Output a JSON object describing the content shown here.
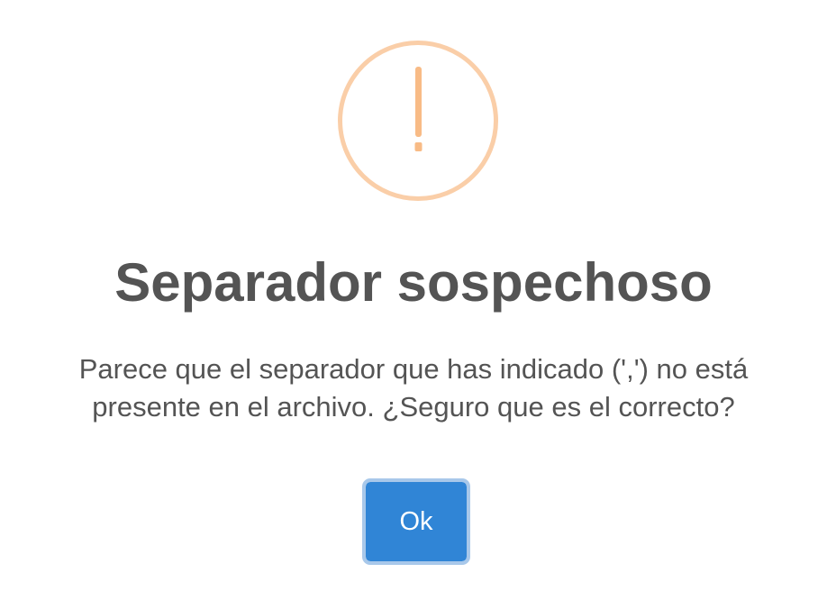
{
  "dialog": {
    "icon": "warning-icon",
    "title": "Separador sospechoso",
    "message_line1": "Parece que el separador que has indicado (',') no está",
    "message_line2": "presente en el archivo. ¿Seguro que es el correcto?",
    "confirm_label": "Ok"
  },
  "colors": {
    "icon_ring": "#facea8",
    "icon_mark": "#f8bb86",
    "text": "#545454",
    "button": "#3085d6",
    "button_focus_ring": "#a8c8ea"
  }
}
